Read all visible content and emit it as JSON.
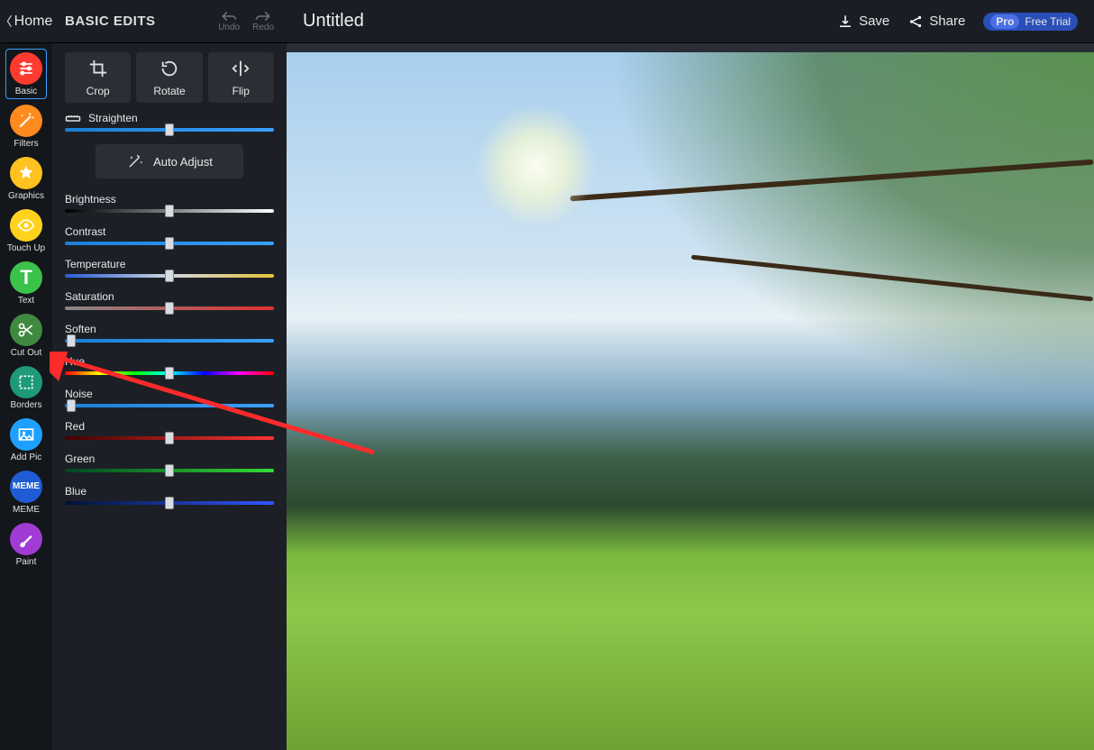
{
  "header": {
    "home": "Home",
    "panel_title": "BASIC EDITS",
    "undo": "Undo",
    "redo": "Redo",
    "doc_title": "Untitled",
    "save": "Save",
    "share": "Share",
    "pro": "Pro",
    "free_trial": "Free Trial"
  },
  "sidebar": {
    "tools": [
      {
        "id": "basic",
        "label": "Basic",
        "color": "#ff3b2f",
        "glyph": "sliders",
        "active": true
      },
      {
        "id": "filters",
        "label": "Filters",
        "color": "#ff8a1e",
        "glyph": "wand",
        "active": false
      },
      {
        "id": "graphics",
        "label": "Graphics",
        "color": "#ffc21e",
        "glyph": "star",
        "active": false
      },
      {
        "id": "touchup",
        "label": "Touch Up",
        "color": "#ffd21e",
        "glyph": "eye",
        "active": false
      },
      {
        "id": "text",
        "label": "Text",
        "color": "#3bc24a",
        "glyph": "T",
        "active": false
      },
      {
        "id": "cutout",
        "label": "Cut Out",
        "color": "#3f8a3f",
        "glyph": "scissors",
        "active": false
      },
      {
        "id": "borders",
        "label": "Borders",
        "color": "#1e9a7a",
        "glyph": "frame",
        "active": false
      },
      {
        "id": "addpic",
        "label": "Add Pic",
        "color": "#1ea0ff",
        "glyph": "image",
        "active": false
      },
      {
        "id": "meme",
        "label": "MEME",
        "color": "#1e5bd4",
        "glyph": "MEME",
        "active": false
      },
      {
        "id": "paint",
        "label": "Paint",
        "color": "#a03bd4",
        "glyph": "brush",
        "active": false
      }
    ]
  },
  "panel": {
    "tool_buttons": [
      {
        "id": "crop",
        "label": "Crop"
      },
      {
        "id": "rotate",
        "label": "Rotate"
      },
      {
        "id": "flip",
        "label": "Flip"
      }
    ],
    "auto_adjust": "Auto Adjust",
    "sliders": [
      {
        "id": "straighten",
        "label": "Straighten",
        "track": "g-blue",
        "pos": 50,
        "icon": true
      },
      {
        "id": "brightness",
        "label": "Brightness",
        "track": "g-bright",
        "pos": 50
      },
      {
        "id": "contrast",
        "label": "Contrast",
        "track": "g-blue",
        "pos": 50
      },
      {
        "id": "temperature",
        "label": "Temperature",
        "track": "g-temp",
        "pos": 50
      },
      {
        "id": "saturation",
        "label": "Saturation",
        "track": "g-sat",
        "pos": 50
      },
      {
        "id": "soften",
        "label": "Soften",
        "track": "g-soft",
        "pos": 3
      },
      {
        "id": "hue",
        "label": "Hue",
        "track": "g-hue",
        "pos": 50
      },
      {
        "id": "noise",
        "label": "Noise",
        "track": "g-blue",
        "pos": 3
      },
      {
        "id": "red",
        "label": "Red",
        "track": "g-red",
        "pos": 50
      },
      {
        "id": "green",
        "label": "Green",
        "track": "g-green",
        "pos": 50
      },
      {
        "id": "blue",
        "label": "Blue",
        "track": "g-bluec",
        "pos": 50
      }
    ]
  },
  "annotation": {
    "target_tool": "cutout",
    "arrow_color": "#ff2a2a"
  }
}
